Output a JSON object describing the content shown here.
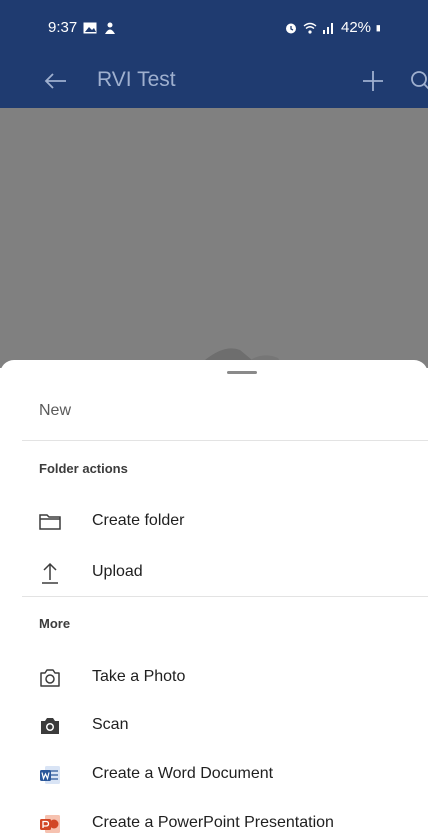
{
  "status_bar": {
    "time": "9:37",
    "battery": "42%",
    "left_icons": [
      "image-notification-icon",
      "person-notification-icon"
    ],
    "right_icons": [
      "alarm-icon",
      "wifi-icon",
      "signal-icon",
      "battery-icon"
    ]
  },
  "app_bar": {
    "title": "RVI Test",
    "color": "#1f3b70"
  },
  "sheet": {
    "title": "New",
    "folder_section_label": "Folder actions",
    "folder_actions": [
      {
        "label": "Create folder",
        "icon": "folder-icon"
      },
      {
        "label": "Upload",
        "icon": "upload-icon"
      }
    ],
    "more_section_label": "More",
    "more_actions": [
      {
        "label": "Take a Photo",
        "icon": "camera-outline-icon"
      },
      {
        "label": "Scan",
        "icon": "camera-filled-icon"
      },
      {
        "label": "Create a Word Document",
        "icon": "word-icon",
        "color": "#2b579a"
      },
      {
        "label": "Create a PowerPoint Presentation",
        "icon": "powerpoint-icon",
        "color": "#d24726"
      }
    ]
  }
}
